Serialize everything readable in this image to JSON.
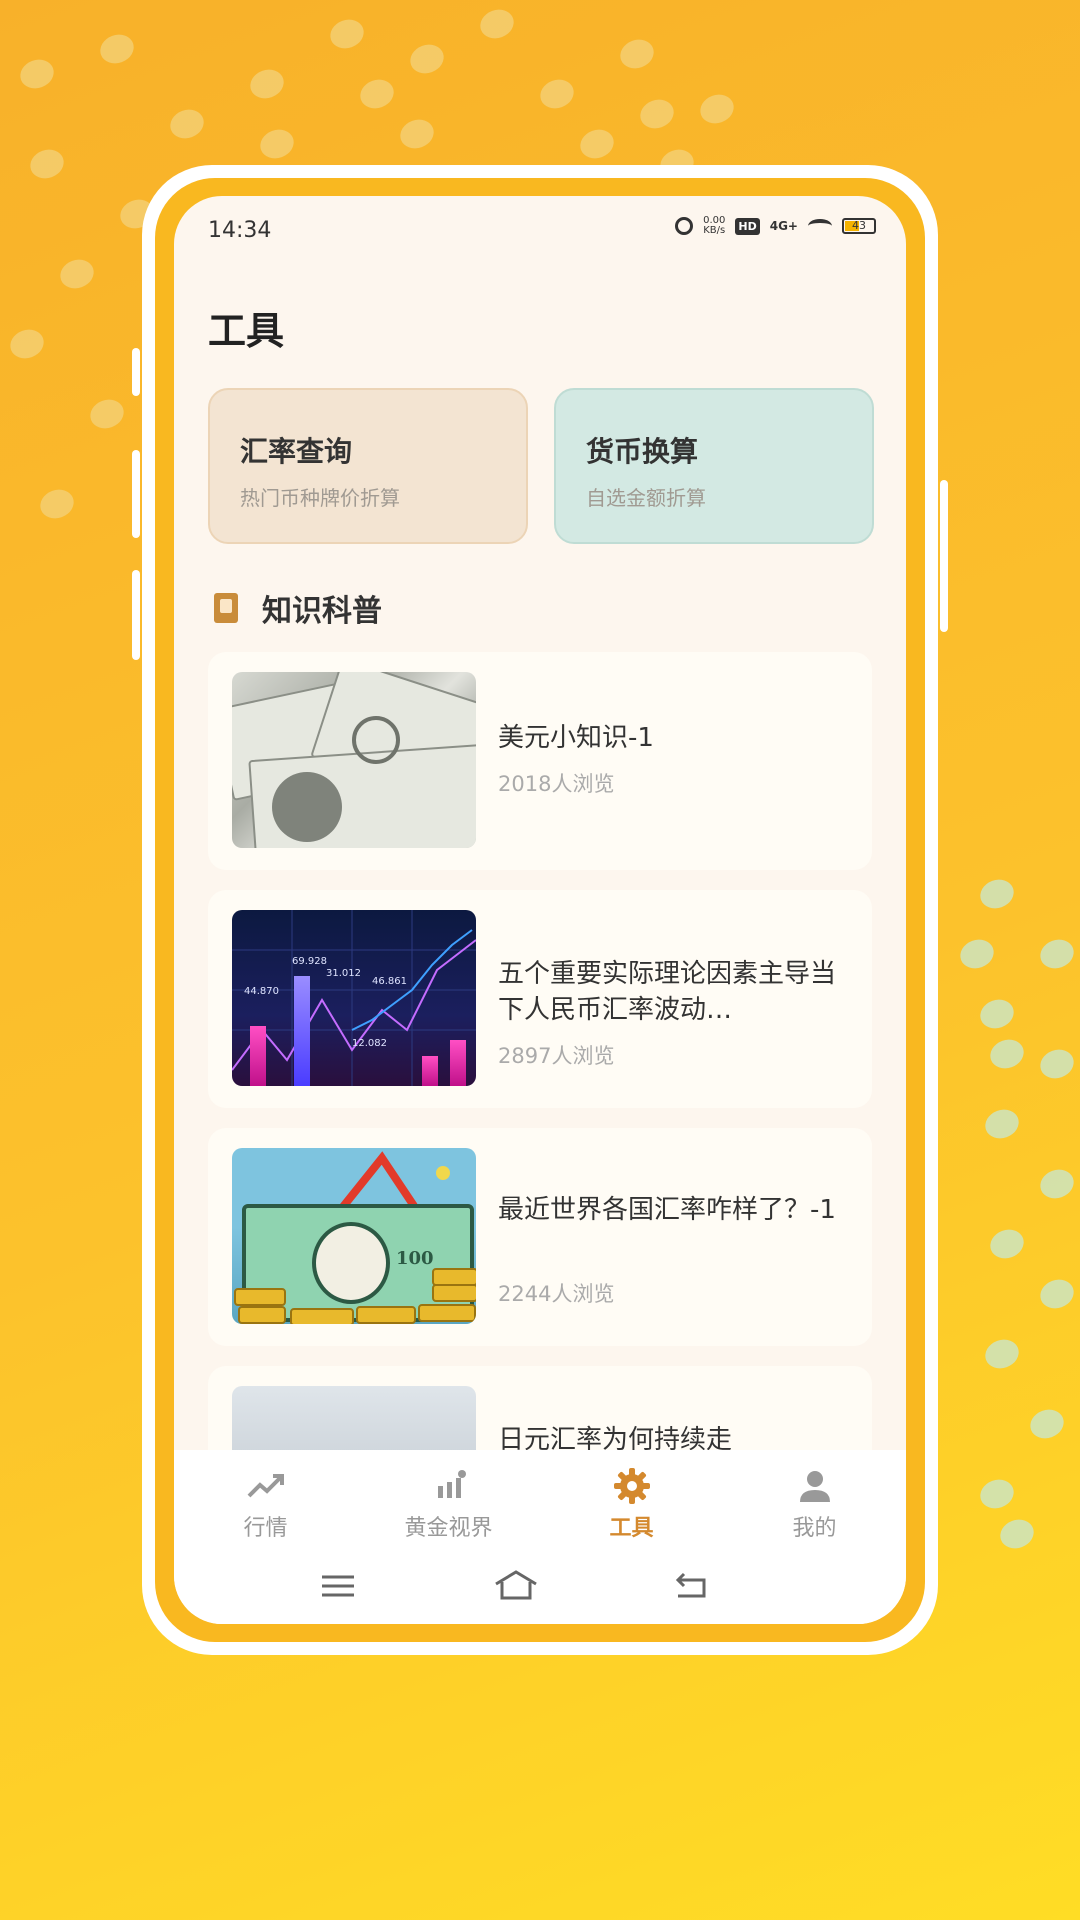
{
  "status_bar": {
    "time": "14:34",
    "speed_value": "0.00",
    "speed_unit": "KB/s",
    "hd": "HD",
    "network": "4G+",
    "battery": "43"
  },
  "page": {
    "title": "工具"
  },
  "tools": [
    {
      "title": "汇率查询",
      "subtitle": "热门币种牌价折算"
    },
    {
      "title": "货币换算",
      "subtitle": "自选金额折算"
    }
  ],
  "knowledge": {
    "section_title": "知识科普",
    "articles": [
      {
        "title": "美元小知识-1",
        "views": "2018人浏览"
      },
      {
        "title": "五个重要实际理论因素主导当下人民币汇率波动…",
        "views": "2897人浏览"
      },
      {
        "title": "最近世界各国汇率咋样了？-1",
        "views": "2244人浏览"
      },
      {
        "title": "日元汇率为何持续走"
      }
    ]
  },
  "thumb_chart_numbers": [
    "44.870",
    "69.928",
    "31.012",
    "46.861",
    "12.082"
  ],
  "thumb_bill_denomination": "100",
  "tab_bar": [
    {
      "label": "行情",
      "icon": "trend-icon"
    },
    {
      "label": "黄金视界",
      "icon": "bar-chart-icon"
    },
    {
      "label": "工具",
      "icon": "gear-icon"
    },
    {
      "label": "我的",
      "icon": "person-icon"
    }
  ],
  "colors": {
    "accent": "#d4892e",
    "background_yellow": "#fcc22c",
    "rate_card": "#f3e4d2",
    "convert_card": "#d3e9e3"
  }
}
